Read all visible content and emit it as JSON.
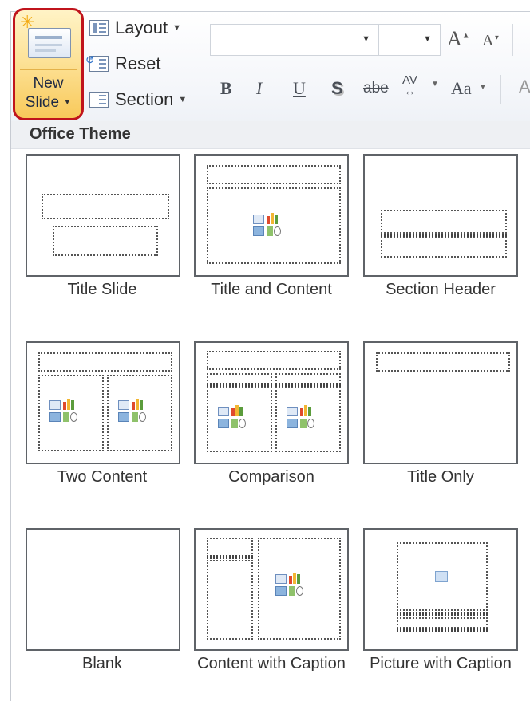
{
  "ribbon": {
    "new_slide": {
      "line1": "New",
      "line2": "Slide"
    },
    "layout_label": "Layout",
    "reset_label": "Reset",
    "section_label": "Section",
    "font": {
      "name_value": "",
      "size_value": "",
      "grow_label": "A",
      "shrink_label": "A"
    },
    "format": {
      "bold": "B",
      "italic": "I",
      "underline": "U",
      "shadow": "S",
      "strikethrough": "abe",
      "spacing": "AV",
      "change_case": "Aa"
    }
  },
  "gallery": {
    "header": "Office Theme",
    "layouts": [
      {
        "label": "Title Slide"
      },
      {
        "label": "Title and Content"
      },
      {
        "label": "Section Header"
      },
      {
        "label": "Two Content"
      },
      {
        "label": "Comparison"
      },
      {
        "label": "Title Only"
      },
      {
        "label": "Blank"
      },
      {
        "label": "Content with Caption"
      },
      {
        "label": "Picture with Caption"
      }
    ]
  },
  "colors": {
    "highlight_border": "#c0141c",
    "button_fill": "#fde39a"
  }
}
